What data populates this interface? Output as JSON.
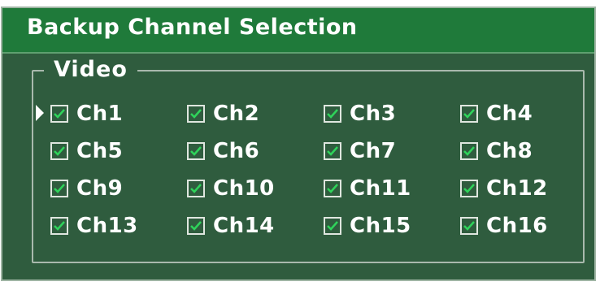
{
  "dialog": {
    "title": "Backup Channel Selection"
  },
  "video_group": {
    "label": "Video",
    "cursor_icon": "selection-pointer-icon",
    "channels": [
      {
        "label": "Ch1",
        "checked": true
      },
      {
        "label": "Ch2",
        "checked": true
      },
      {
        "label": "Ch3",
        "checked": true
      },
      {
        "label": "Ch4",
        "checked": true
      },
      {
        "label": "Ch5",
        "checked": true
      },
      {
        "label": "Ch6",
        "checked": true
      },
      {
        "label": "Ch7",
        "checked": true
      },
      {
        "label": "Ch8",
        "checked": true
      },
      {
        "label": "Ch9",
        "checked": true
      },
      {
        "label": "Ch10",
        "checked": true
      },
      {
        "label": "Ch11",
        "checked": true
      },
      {
        "label": "Ch12",
        "checked": true
      },
      {
        "label": "Ch13",
        "checked": true
      },
      {
        "label": "Ch14",
        "checked": true
      },
      {
        "label": "Ch15",
        "checked": true
      },
      {
        "label": "Ch16",
        "checked": true
      }
    ]
  },
  "colors": {
    "panel_background": "#2f5c3e",
    "title_bar": "#1f7a3a",
    "text": "#ffffff",
    "checkmark": "#2fd35a"
  }
}
